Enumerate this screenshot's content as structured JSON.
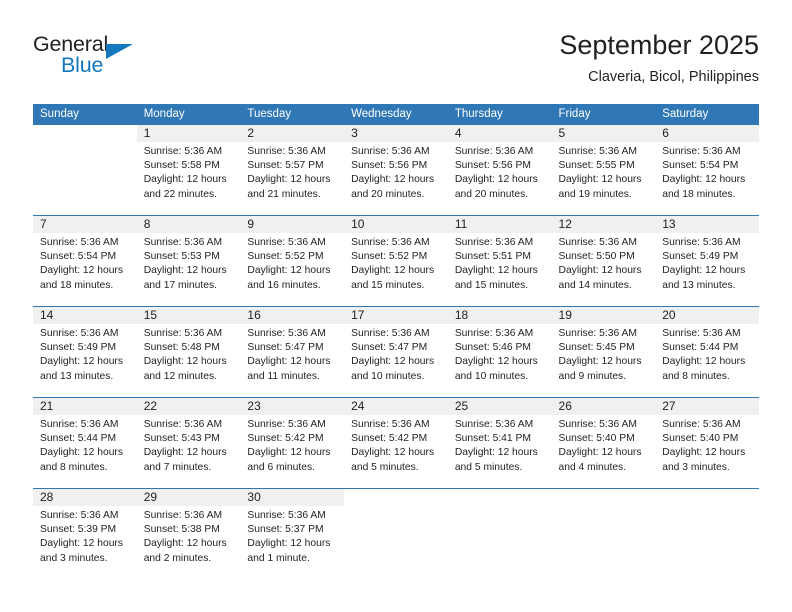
{
  "logo": {
    "word1": "General",
    "word2": "Blue",
    "accent_color": "#1577bd",
    "text_color": "#231f20"
  },
  "header": {
    "title": "September 2025",
    "subtitle": "Claveria, Bicol, Philippines"
  },
  "theme": {
    "header_blue": "#3077b5",
    "day_band_gray": "#f0f0f0",
    "text": "#231f20"
  },
  "weekday_headers": [
    "Sunday",
    "Monday",
    "Tuesday",
    "Wednesday",
    "Thursday",
    "Friday",
    "Saturday"
  ],
  "weeks": [
    {
      "days": [
        {
          "number": "",
          "blank": true,
          "lines": []
        },
        {
          "number": "1",
          "lines": [
            "Sunrise: 5:36 AM",
            "Sunset: 5:58 PM",
            "Daylight: 12 hours",
            "and 22 minutes."
          ]
        },
        {
          "number": "2",
          "lines": [
            "Sunrise: 5:36 AM",
            "Sunset: 5:57 PM",
            "Daylight: 12 hours",
            "and 21 minutes."
          ]
        },
        {
          "number": "3",
          "lines": [
            "Sunrise: 5:36 AM",
            "Sunset: 5:56 PM",
            "Daylight: 12 hours",
            "and 20 minutes."
          ]
        },
        {
          "number": "4",
          "lines": [
            "Sunrise: 5:36 AM",
            "Sunset: 5:56 PM",
            "Daylight: 12 hours",
            "and 20 minutes."
          ]
        },
        {
          "number": "5",
          "lines": [
            "Sunrise: 5:36 AM",
            "Sunset: 5:55 PM",
            "Daylight: 12 hours",
            "and 19 minutes."
          ]
        },
        {
          "number": "6",
          "lines": [
            "Sunrise: 5:36 AM",
            "Sunset: 5:54 PM",
            "Daylight: 12 hours",
            "and 18 minutes."
          ]
        }
      ]
    },
    {
      "days": [
        {
          "number": "7",
          "lines": [
            "Sunrise: 5:36 AM",
            "Sunset: 5:54 PM",
            "Daylight: 12 hours",
            "and 18 minutes."
          ]
        },
        {
          "number": "8",
          "lines": [
            "Sunrise: 5:36 AM",
            "Sunset: 5:53 PM",
            "Daylight: 12 hours",
            "and 17 minutes."
          ]
        },
        {
          "number": "9",
          "lines": [
            "Sunrise: 5:36 AM",
            "Sunset: 5:52 PM",
            "Daylight: 12 hours",
            "and 16 minutes."
          ]
        },
        {
          "number": "10",
          "lines": [
            "Sunrise: 5:36 AM",
            "Sunset: 5:52 PM",
            "Daylight: 12 hours",
            "and 15 minutes."
          ]
        },
        {
          "number": "11",
          "lines": [
            "Sunrise: 5:36 AM",
            "Sunset: 5:51 PM",
            "Daylight: 12 hours",
            "and 15 minutes."
          ]
        },
        {
          "number": "12",
          "lines": [
            "Sunrise: 5:36 AM",
            "Sunset: 5:50 PM",
            "Daylight: 12 hours",
            "and 14 minutes."
          ]
        },
        {
          "number": "13",
          "lines": [
            "Sunrise: 5:36 AM",
            "Sunset: 5:49 PM",
            "Daylight: 12 hours",
            "and 13 minutes."
          ]
        }
      ]
    },
    {
      "days": [
        {
          "number": "14",
          "lines": [
            "Sunrise: 5:36 AM",
            "Sunset: 5:49 PM",
            "Daylight: 12 hours",
            "and 13 minutes."
          ]
        },
        {
          "number": "15",
          "lines": [
            "Sunrise: 5:36 AM",
            "Sunset: 5:48 PM",
            "Daylight: 12 hours",
            "and 12 minutes."
          ]
        },
        {
          "number": "16",
          "lines": [
            "Sunrise: 5:36 AM",
            "Sunset: 5:47 PM",
            "Daylight: 12 hours",
            "and 11 minutes."
          ]
        },
        {
          "number": "17",
          "lines": [
            "Sunrise: 5:36 AM",
            "Sunset: 5:47 PM",
            "Daylight: 12 hours",
            "and 10 minutes."
          ]
        },
        {
          "number": "18",
          "lines": [
            "Sunrise: 5:36 AM",
            "Sunset: 5:46 PM",
            "Daylight: 12 hours",
            "and 10 minutes."
          ]
        },
        {
          "number": "19",
          "lines": [
            "Sunrise: 5:36 AM",
            "Sunset: 5:45 PM",
            "Daylight: 12 hours",
            "and 9 minutes."
          ]
        },
        {
          "number": "20",
          "lines": [
            "Sunrise: 5:36 AM",
            "Sunset: 5:44 PM",
            "Daylight: 12 hours",
            "and 8 minutes."
          ]
        }
      ]
    },
    {
      "days": [
        {
          "number": "21",
          "lines": [
            "Sunrise: 5:36 AM",
            "Sunset: 5:44 PM",
            "Daylight: 12 hours",
            "and 8 minutes."
          ]
        },
        {
          "number": "22",
          "lines": [
            "Sunrise: 5:36 AM",
            "Sunset: 5:43 PM",
            "Daylight: 12 hours",
            "and 7 minutes."
          ]
        },
        {
          "number": "23",
          "lines": [
            "Sunrise: 5:36 AM",
            "Sunset: 5:42 PM",
            "Daylight: 12 hours",
            "and 6 minutes."
          ]
        },
        {
          "number": "24",
          "lines": [
            "Sunrise: 5:36 AM",
            "Sunset: 5:42 PM",
            "Daylight: 12 hours",
            "and 5 minutes."
          ]
        },
        {
          "number": "25",
          "lines": [
            "Sunrise: 5:36 AM",
            "Sunset: 5:41 PM",
            "Daylight: 12 hours",
            "and 5 minutes."
          ]
        },
        {
          "number": "26",
          "lines": [
            "Sunrise: 5:36 AM",
            "Sunset: 5:40 PM",
            "Daylight: 12 hours",
            "and 4 minutes."
          ]
        },
        {
          "number": "27",
          "lines": [
            "Sunrise: 5:36 AM",
            "Sunset: 5:40 PM",
            "Daylight: 12 hours",
            "and 3 minutes."
          ]
        }
      ]
    },
    {
      "days": [
        {
          "number": "28",
          "lines": [
            "Sunrise: 5:36 AM",
            "Sunset: 5:39 PM",
            "Daylight: 12 hours",
            "and 3 minutes."
          ]
        },
        {
          "number": "29",
          "lines": [
            "Sunrise: 5:36 AM",
            "Sunset: 5:38 PM",
            "Daylight: 12 hours",
            "and 2 minutes."
          ]
        },
        {
          "number": "30",
          "lines": [
            "Sunrise: 5:36 AM",
            "Sunset: 5:37 PM",
            "Daylight: 12 hours",
            "and 1 minute."
          ]
        },
        {
          "number": "",
          "blank": true,
          "lines": []
        },
        {
          "number": "",
          "blank": true,
          "lines": []
        },
        {
          "number": "",
          "blank": true,
          "lines": []
        },
        {
          "number": "",
          "blank": true,
          "lines": []
        }
      ]
    }
  ]
}
